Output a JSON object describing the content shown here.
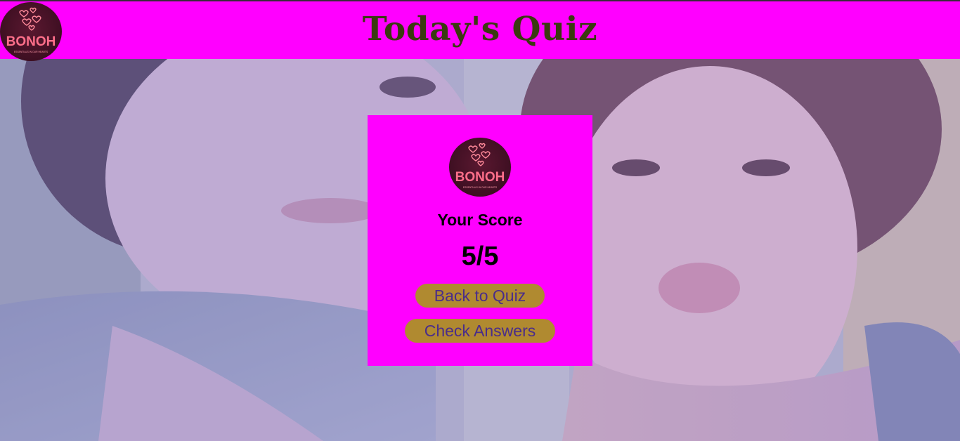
{
  "header": {
    "title": "Today's Quiz",
    "logo_icon": "bonoh-logo-icon"
  },
  "logo": {
    "brand": "BONOH",
    "tagline": "ESSENTIALS IN OUR HEARTS"
  },
  "card": {
    "score_label": "Your Score",
    "score_value": "5/5",
    "back_label": "Back to Quiz",
    "check_label": "Check Answers"
  },
  "colors": {
    "header_bg": "#ff00ff",
    "card_bg": "#ff00ff",
    "title_color": "#3b3a10",
    "button_bg": "#b08a30",
    "button_text": "#4a2d8a"
  }
}
